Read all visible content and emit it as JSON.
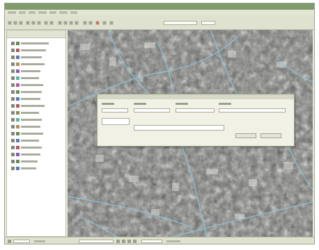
{
  "window": {
    "title": ""
  },
  "menu": {
    "items": [
      "",
      "",
      "",
      "",
      "",
      "",
      ""
    ]
  },
  "toolbar": {
    "icons": [
      "open-icon",
      "save-icon",
      "print-icon",
      "cut-icon",
      "copy-icon",
      "paste-icon",
      "undo-icon",
      "redo-icon",
      "zoom-in-icon",
      "zoom-out-icon",
      "pan-icon",
      "select-icon",
      "identify-icon",
      "measure-icon",
      "stop-icon",
      "refresh-icon",
      "layers-icon"
    ],
    "scale_value": "",
    "zoom_value": ""
  },
  "layer_panel": {
    "title": "",
    "layers": [
      {
        "name": "",
        "color": "#6a8a58"
      },
      {
        "name": "",
        "color": "#b35b5b"
      },
      {
        "name": "",
        "color": "#5b78b3"
      },
      {
        "name": "",
        "color": "#b38f5b"
      },
      {
        "name": "",
        "color": "#8a5bb3"
      },
      {
        "name": "",
        "color": "#5bb3a8"
      },
      {
        "name": "",
        "color": "#b35b95"
      },
      {
        "name": "",
        "color": "#6a8a58"
      },
      {
        "name": "",
        "color": "#5b78b3"
      },
      {
        "name": "",
        "color": "#b35b5b"
      },
      {
        "name": "",
        "color": "#8a8a58"
      },
      {
        "name": "",
        "color": "#5bb3a8"
      },
      {
        "name": "",
        "color": "#b38f5b"
      },
      {
        "name": "",
        "color": "#6a8a58"
      },
      {
        "name": "",
        "color": "#5b78b3"
      },
      {
        "name": "",
        "color": "#b35b5b"
      },
      {
        "name": "",
        "color": "#8a5bb3"
      },
      {
        "name": "",
        "color": "#6a8a58"
      },
      {
        "name": "",
        "color": "#5b78b3"
      }
    ]
  },
  "dialog": {
    "title": "",
    "field_labels": [
      "",
      "",
      "",
      ""
    ],
    "field_values": [
      "",
      "",
      "",
      ""
    ],
    "message": "",
    "ok_label": "",
    "cancel_label": ""
  },
  "statusbar": {
    "coordinates": "",
    "scale": ""
  },
  "colors": {
    "titlebar": "#7f9a6b",
    "road_lines": "#8ec6d8",
    "warning_text": "#e05a31"
  }
}
